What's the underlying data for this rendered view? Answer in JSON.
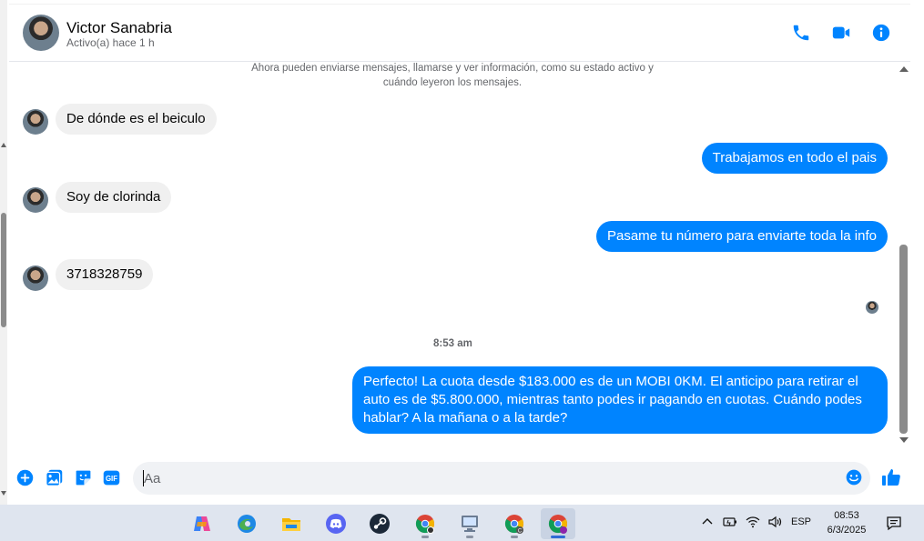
{
  "header": {
    "contact_name": "Victor Sanabria",
    "contact_status": "Activo(a) hace 1 h",
    "icons": [
      "phone-icon",
      "video-camera-icon",
      "info-icon"
    ]
  },
  "conversation": {
    "notice": "Ahora pueden enviarse mensajes, llamarse y ver información, como su estado activo y cuándo leyeron los mensajes.",
    "messages": [
      {
        "from": "contact",
        "text": "De dónde es el beiculo"
      },
      {
        "from": "me",
        "text": "Trabajamos en todo el pais"
      },
      {
        "from": "contact",
        "text": "Soy de clorinda"
      },
      {
        "from": "me",
        "text": "Pasame tu número para enviarte toda la info"
      },
      {
        "from": "contact",
        "text": "3718328759"
      },
      {
        "from": "me",
        "text": "Perfecto! La cuota desde $183.000 es de un MOBI 0KM. El anticipo para retirar el auto es de $5.800.000, mientras tanto podes ir pagando en cuotas. Cuándo podes hablar? A la mañana o a la tarde?"
      }
    ],
    "timestamp": "8:53 am"
  },
  "composer": {
    "placeholder": "Aa",
    "value": "",
    "icons": [
      "plus-icon",
      "image-icon",
      "sticker-icon",
      "gif-icon",
      "emoji-icon",
      "like-icon"
    ],
    "gif_label": "GIF"
  },
  "colors": {
    "accent": "#0084ff",
    "incoming_bubble": "#f0f0f0",
    "taskbar": "#dfe5ef"
  },
  "taskbar": {
    "apps": [
      "copilot-icon",
      "edge-icon",
      "file-explorer-icon",
      "discord-icon",
      "steam-icon",
      "chrome-icon",
      "remote-desktop-icon",
      "chrome-profile-icon",
      "chrome-profile-active-icon"
    ],
    "language": "ESP",
    "time": "08:53",
    "date": "6/3/2025"
  }
}
